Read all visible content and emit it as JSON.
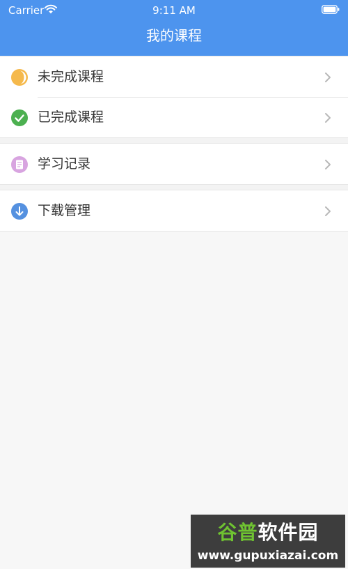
{
  "status_bar": {
    "carrier": "Carrier",
    "time": "9:11 AM",
    "wifi_icon": "wifi-icon",
    "battery_icon": "battery-icon"
  },
  "nav": {
    "title": "我的课程"
  },
  "menu": {
    "groups": [
      {
        "items": [
          {
            "label": "未完成课程",
            "icon": "half-moon-icon",
            "icon_color": "#f5b94c"
          },
          {
            "label": "已完成课程",
            "icon": "check-circle-icon",
            "icon_color": "#4cb050"
          }
        ]
      },
      {
        "items": [
          {
            "label": "学习记录",
            "icon": "document-icon",
            "icon_color": "#d8a4e0"
          }
        ]
      },
      {
        "items": [
          {
            "label": "下载管理",
            "icon": "download-icon",
            "icon_color": "#5591e0"
          }
        ]
      }
    ],
    "chevron_icon": "chevron-right-icon"
  },
  "watermark": {
    "title_part1": "谷普",
    "title_part2": "软件园",
    "url": "www.gupuxiazai.com"
  },
  "colors": {
    "header": "#4d94ee",
    "background": "#f7f7f7",
    "row": "#ffffff",
    "text": "#333333",
    "divider": "#e6e6e6"
  }
}
